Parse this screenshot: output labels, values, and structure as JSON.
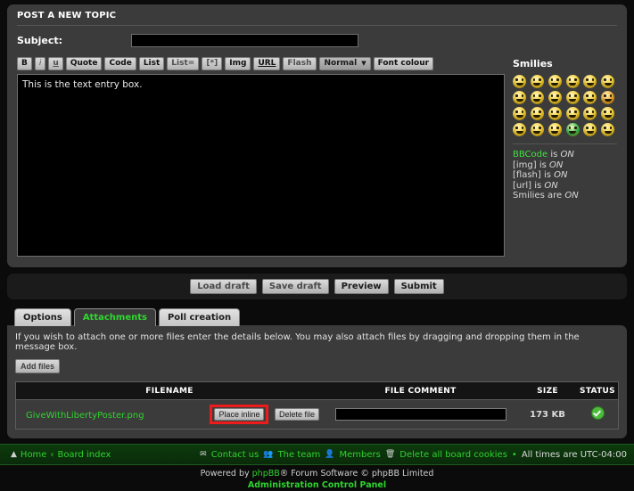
{
  "post_panel": {
    "title": "POST A NEW TOPIC",
    "subject_label": "Subject:",
    "subject_value": "",
    "subject_placeholder": ""
  },
  "toolbar": {
    "bold": "B",
    "italic": "i",
    "underline": "u",
    "quote": "Quote",
    "code": "Code",
    "list": "List",
    "list_eq": "List=",
    "list_item": "[*]",
    "img": "Img",
    "url": "URL",
    "flash": "Flash",
    "font_size_selected": "Normal",
    "font_colour": "Font colour"
  },
  "message": {
    "value": "This is the text entry box."
  },
  "smilies": {
    "title": "Smilies",
    "items": [
      {
        "name": "smilie-biggrin",
        "color": "#f6cf2e"
      },
      {
        "name": "smilie-smile",
        "color": "#f6cf2e"
      },
      {
        "name": "smilie-wink",
        "color": "#f6cf2e"
      },
      {
        "name": "smilie-sad",
        "color": "#f6cf2e"
      },
      {
        "name": "smilie-surprised",
        "color": "#f6cf2e"
      },
      {
        "name": "smilie-shocked",
        "color": "#f6cf2e"
      },
      {
        "name": "smilie-confused",
        "color": "#f6cf2e"
      },
      {
        "name": "smilie-cool",
        "color": "#f6cf2e"
      },
      {
        "name": "smilie-laughing",
        "color": "#f6cf2e"
      },
      {
        "name": "smilie-mad",
        "color": "#f6cf2e"
      },
      {
        "name": "smilie-razz",
        "color": "#f6cf2e"
      },
      {
        "name": "smilie-embarrassed",
        "color": "#f0a32a"
      },
      {
        "name": "smilie-crying",
        "color": "#f6cf2e"
      },
      {
        "name": "smilie-evil",
        "color": "#f6cf2e"
      },
      {
        "name": "smilie-twisted",
        "color": "#f6cf2e"
      },
      {
        "name": "smilie-rolleyes",
        "color": "#f6cf2e"
      },
      {
        "name": "smilie-exclamation",
        "color": "#f6cf2e"
      },
      {
        "name": "smilie-question",
        "color": "#f6cf2e"
      },
      {
        "name": "smilie-idea",
        "color": "#f6cf2e"
      },
      {
        "name": "smilie-arrow",
        "color": "#f6cf2e"
      },
      {
        "name": "smilie-neutral",
        "color": "#f6cf2e"
      },
      {
        "name": "smilie-mrgreen",
        "color": "#2fbb4e"
      },
      {
        "name": "smilie-geek",
        "color": "#f6cf2e"
      },
      {
        "name": "smilie-ugeek",
        "color": "#f6cf2e"
      }
    ]
  },
  "bbcode_status": [
    {
      "label": "BBCode",
      "mid": " is ",
      "state": "ON",
      "link": true
    },
    {
      "label": "[img]",
      "mid": " is ",
      "state": "ON",
      "link": false
    },
    {
      "label": "[flash]",
      "mid": " is ",
      "state": "ON",
      "link": false
    },
    {
      "label": "[url]",
      "mid": " is ",
      "state": "ON",
      "link": false
    },
    {
      "label": "Smilies",
      "mid": " are ",
      "state": "ON",
      "link": false
    }
  ],
  "submit_bar": {
    "load_draft": "Load draft",
    "save_draft": "Save draft",
    "preview": "Preview",
    "submit": "Submit"
  },
  "tabs": [
    {
      "label": "Options",
      "active": false
    },
    {
      "label": "Attachments",
      "active": true
    },
    {
      "label": "Poll creation",
      "active": false
    }
  ],
  "attachments": {
    "note": "If you wish to attach one or more files enter the details below. You may also attach files by dragging and dropping them in the message box.",
    "add_files": "Add files",
    "columns": [
      "FILENAME",
      "FILE COMMENT",
      "SIZE",
      "STATUS"
    ],
    "rows": [
      {
        "filename": "GiveWithLibertyPoster.png",
        "place_inline": "Place inline",
        "delete_file": "Delete file",
        "comment": "",
        "size": "173 KB",
        "status": "ok"
      }
    ],
    "highlight_color": "#ee1b1b"
  },
  "footer": {
    "home": "Home",
    "separator": "‹",
    "board_index": "Board index",
    "contact_us": "Contact us",
    "the_team": "The team",
    "members": "Members",
    "delete_cookies": "Delete all board cookies",
    "bullet": "•",
    "times": "All times are UTC-04:00",
    "powered_prefix": "Powered by ",
    "powered_brand": "phpBB",
    "powered_suffix": "® Forum Software © phpBB Limited",
    "acp": "Administration Control Panel"
  }
}
